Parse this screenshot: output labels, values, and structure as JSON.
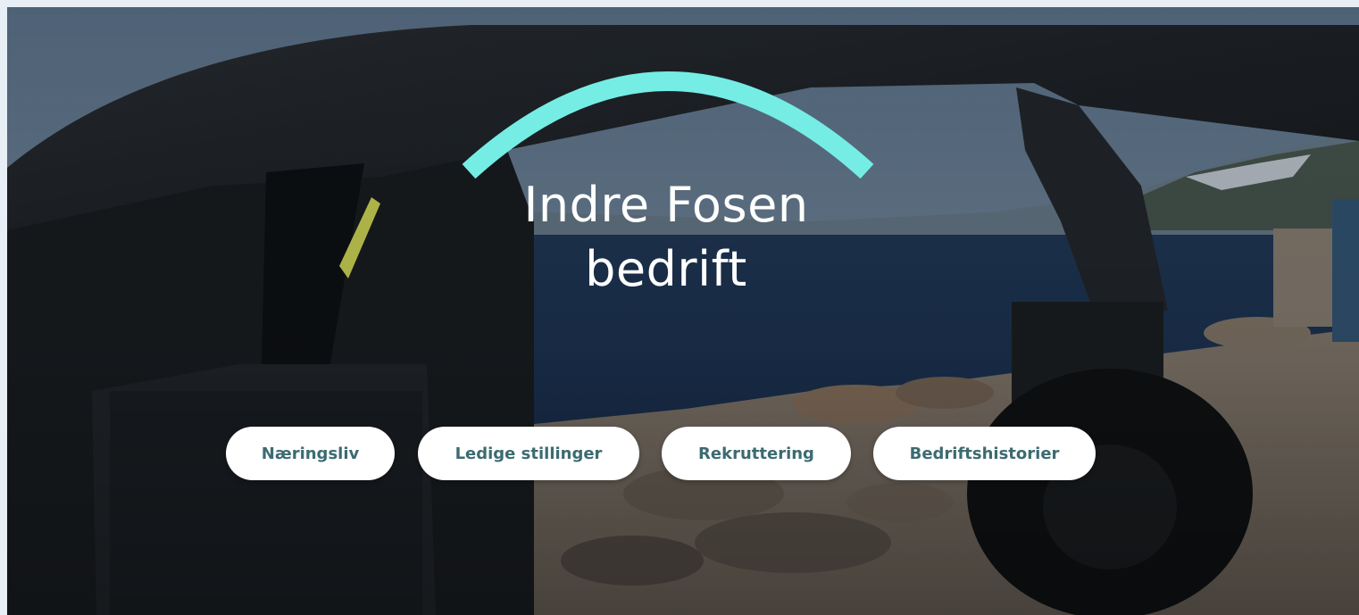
{
  "hero": {
    "title_line1": "Indre Fosen",
    "title_line2": "bedrift",
    "arc_color": "#75ede5"
  },
  "nav": {
    "items": [
      {
        "label": "Næringsliv"
      },
      {
        "label": "Ledige stillinger"
      },
      {
        "label": "Rekruttering"
      },
      {
        "label": "Bedriftshistorier"
      }
    ]
  },
  "theme": {
    "button_bg": "#ffffff",
    "button_text": "#3c6b70"
  }
}
